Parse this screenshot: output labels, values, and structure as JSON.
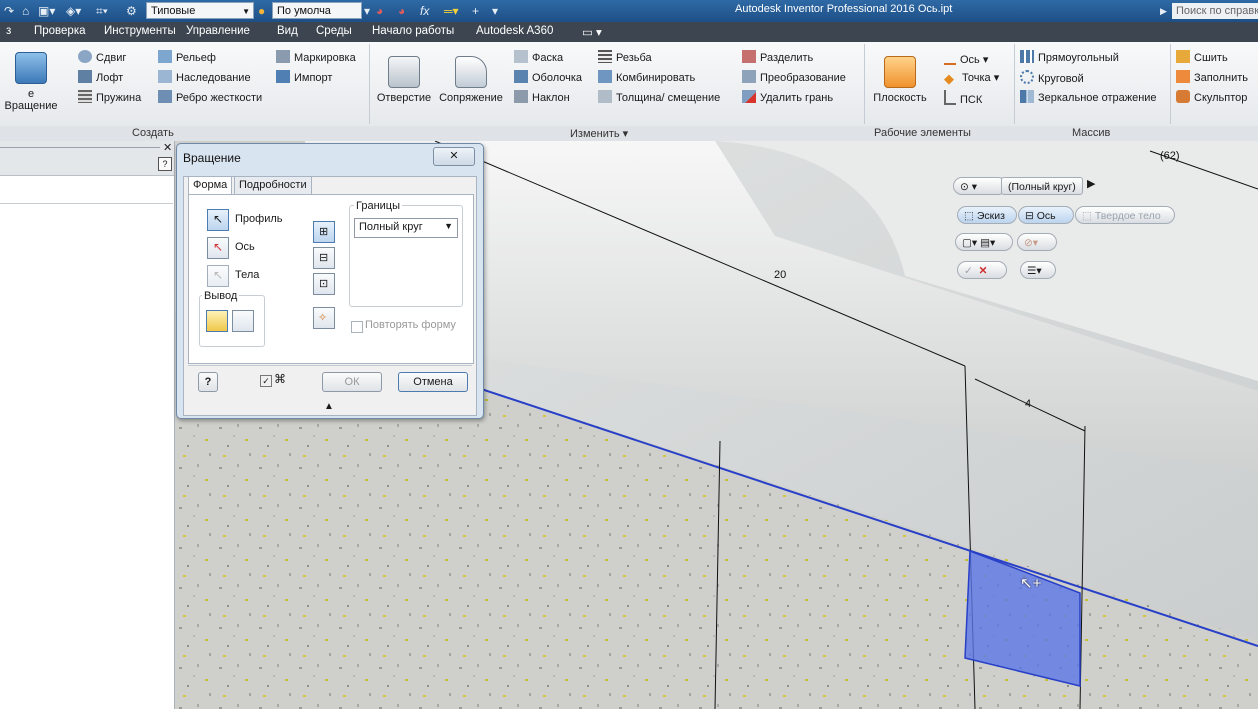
{
  "titlebar": {
    "style_dropdown": "Типовые",
    "appearance_dropdown": "По умолча",
    "app_title": "Autodesk Inventor Professional 2016   Ось.ipt",
    "help_search_placeholder": "Поиск по справке"
  },
  "menu": {
    "tabs": [
      "з",
      "Проверка",
      "Инструменты",
      "Управление",
      "Вид",
      "Среды",
      "Начало работы",
      "Autodesk A360",
      "▭ ▾"
    ]
  },
  "ribbon": {
    "create": {
      "revolve_label": "е Вращение",
      "sweep": "Сдвиг",
      "loft": "Лофт",
      "coil": "Пружина",
      "emboss": "Рельеф",
      "derive": "Наследование",
      "rib": "Ребро жесткости",
      "mark": "Маркировка",
      "import": "Импорт"
    },
    "modify": {
      "hole": "Отверстие",
      "fillet": "Сопряжение",
      "chamfer": "Фаска",
      "shell": "Оболочка",
      "draft": "Наклон",
      "thread": "Резьба",
      "combine": "Комбинировать",
      "thicken": "Толщина/ смещение",
      "split": "Разделить",
      "direct": "Преобразование",
      "delete_face": "Удалить грань"
    },
    "work": {
      "plane": "Плоскость",
      "axis": "Ось",
      "point": "Точка",
      "ucs": "ПСК"
    },
    "pattern": {
      "rect": "Прямоугольный",
      "circ": "Круговой",
      "mirror": "Зеркальное отражение"
    },
    "surface": {
      "stitch": "Сшить",
      "patch": "Заполнить",
      "sculpt": "Скульптор"
    }
  },
  "panels": {
    "create": "Создать",
    "modify": "Изменить ▾",
    "work": "Рабочие элементы",
    "pattern": "Массив"
  },
  "dialog": {
    "title": "Вращение",
    "close": "✕",
    "tab_shape": "Форма",
    "tab_more": "Подробности",
    "profile": "Профиль",
    "axis": "Ось",
    "solids": "Тела",
    "output": "Вывод",
    "extents": "Границы",
    "extents_value": "Полный круг",
    "match_shape": "Повторять форму",
    "ok": "ОК",
    "cancel": "Отмена",
    "help": "?"
  },
  "minitoolbar": {
    "extent_value": "(Полный круг)",
    "sketch": "Эскиз",
    "axis": "Ось",
    "solid": "Твердое тело"
  },
  "dimensions": {
    "d1": "20",
    "d2": "4",
    "d3": "(62)"
  },
  "colors": {
    "accent": "#2f6aa6",
    "profile_fill": "#5b76e6",
    "edge": "#2840c8"
  }
}
